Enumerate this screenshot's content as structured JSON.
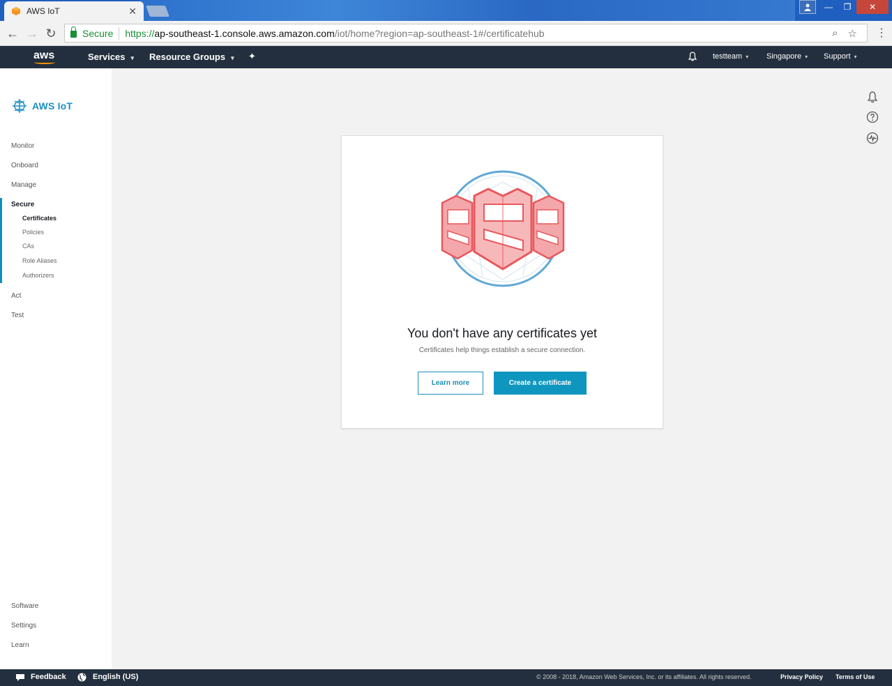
{
  "browser": {
    "tab_title": "AWS IoT",
    "tab_close": "✕",
    "secure_label": "Secure",
    "url_scheme": "https://",
    "url_host": "ap-southeast-1.console.aws.amazon.com",
    "url_path": "/iot/home?region=ap-southeast-1#/certificatehub",
    "back": "←",
    "forward": "→",
    "reload": "↻",
    "zoom_icon": "⌕",
    "star_icon": "☆",
    "menu_icon": "⋮",
    "window_controls": {
      "minimize": "—",
      "maximize": "❐",
      "close": "✕"
    }
  },
  "nav": {
    "logo": "aws",
    "services": "Services",
    "resource_groups": "Resource Groups",
    "pin_icon": "✦",
    "account": "testteam",
    "region": "Singapore",
    "support": "Support",
    "caret": "▾"
  },
  "sidebar": {
    "brand": "AWS IoT",
    "items": {
      "monitor": "Monitor",
      "onboard": "Onboard",
      "manage": "Manage",
      "secure": "Secure",
      "act": "Act",
      "test": "Test",
      "software": "Software",
      "settings": "Settings",
      "learn": "Learn"
    },
    "secure_sub": {
      "certificates": "Certificates",
      "policies": "Policies",
      "cas": "CAs",
      "role_aliases": "Role Aliases",
      "authorizers": "Authorizers"
    }
  },
  "main": {
    "empty_title": "You don't have any certificates yet",
    "empty_subtitle": "Certificates help things establish a secure connection.",
    "learn_more": "Learn more",
    "create_certificate": "Create a certificate"
  },
  "footer": {
    "feedback": "Feedback",
    "language": "English (US)",
    "copyright": "© 2008 - 2018, Amazon Web Services, Inc. or its affiliates. All rights reserved.",
    "privacy": "Privacy Policy",
    "terms": "Terms of Use"
  },
  "colors": {
    "accent": "#0f96be",
    "nav_bg": "#232f3e",
    "secure_green": "#1a8f36",
    "shield_red": "#e8585d"
  }
}
